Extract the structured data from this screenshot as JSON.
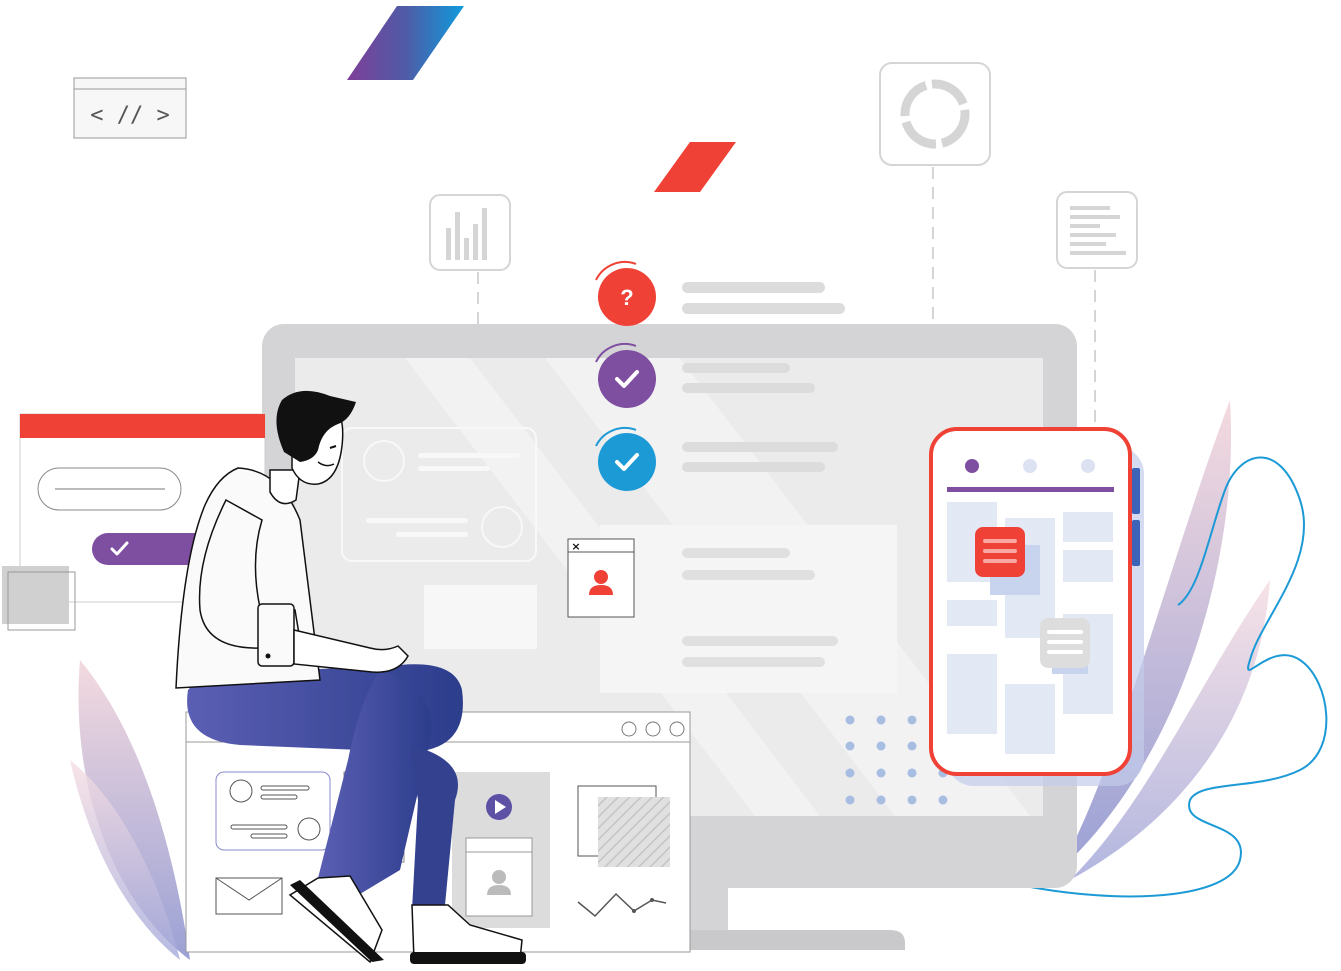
{
  "illustration": {
    "code_snippet": "< // >",
    "question_mark": "?",
    "close_glyph": "×",
    "checklist": [
      {
        "status": "question",
        "color": "#ef4136"
      },
      {
        "status": "done",
        "color": "#7e4ea1"
      },
      {
        "status": "done",
        "color": "#1c9ad6"
      }
    ],
    "phone_tabs": 3,
    "colors": {
      "accent_red": "#ef4136",
      "accent_purple": "#7e4ea1",
      "accent_blue": "#1c9ad6",
      "trouser_blue": "#3a4596",
      "monitor_gray": "#d4d4d6"
    },
    "icons": [
      "code-icon",
      "bar-chart-icon",
      "donut-chart-icon",
      "text-document-icon",
      "question-icon",
      "check-icon",
      "user-icon",
      "play-icon",
      "mail-icon",
      "line-chart-icon",
      "close-icon"
    ]
  }
}
